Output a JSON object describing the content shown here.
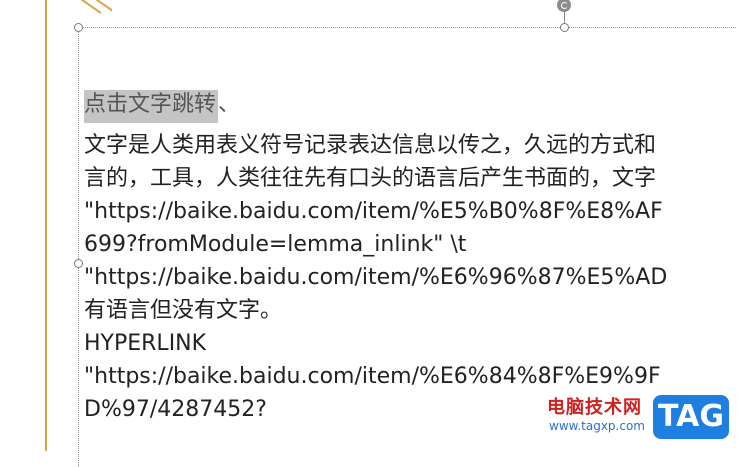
{
  "document": {
    "heading_highlight": "点击文字跳转",
    "heading_rest": "、",
    "lines": [
      "文字是人类用表义符号记录表达信息以传之，久远的方式和",
      "言的，工具，人类往往先有口头的语言后产生书面的，文字",
      "\"https://baike.baidu.com/item/%E5%B0%8F%E8%AF",
      "699?fromModule=lemma_inlink\" \\t",
      "\"https://baike.baidu.com/item/%E6%96%87%E5%AD",
      "有语言但没有文字。",
      "HYPERLINK",
      "\"https://baike.baidu.com/item/%E6%84%8F%E9%9F",
      "D%97/4287452?"
    ]
  },
  "watermark": {
    "site_name": "电脑技术网",
    "url": "www.tagxp.com",
    "badge": "TAG"
  }
}
